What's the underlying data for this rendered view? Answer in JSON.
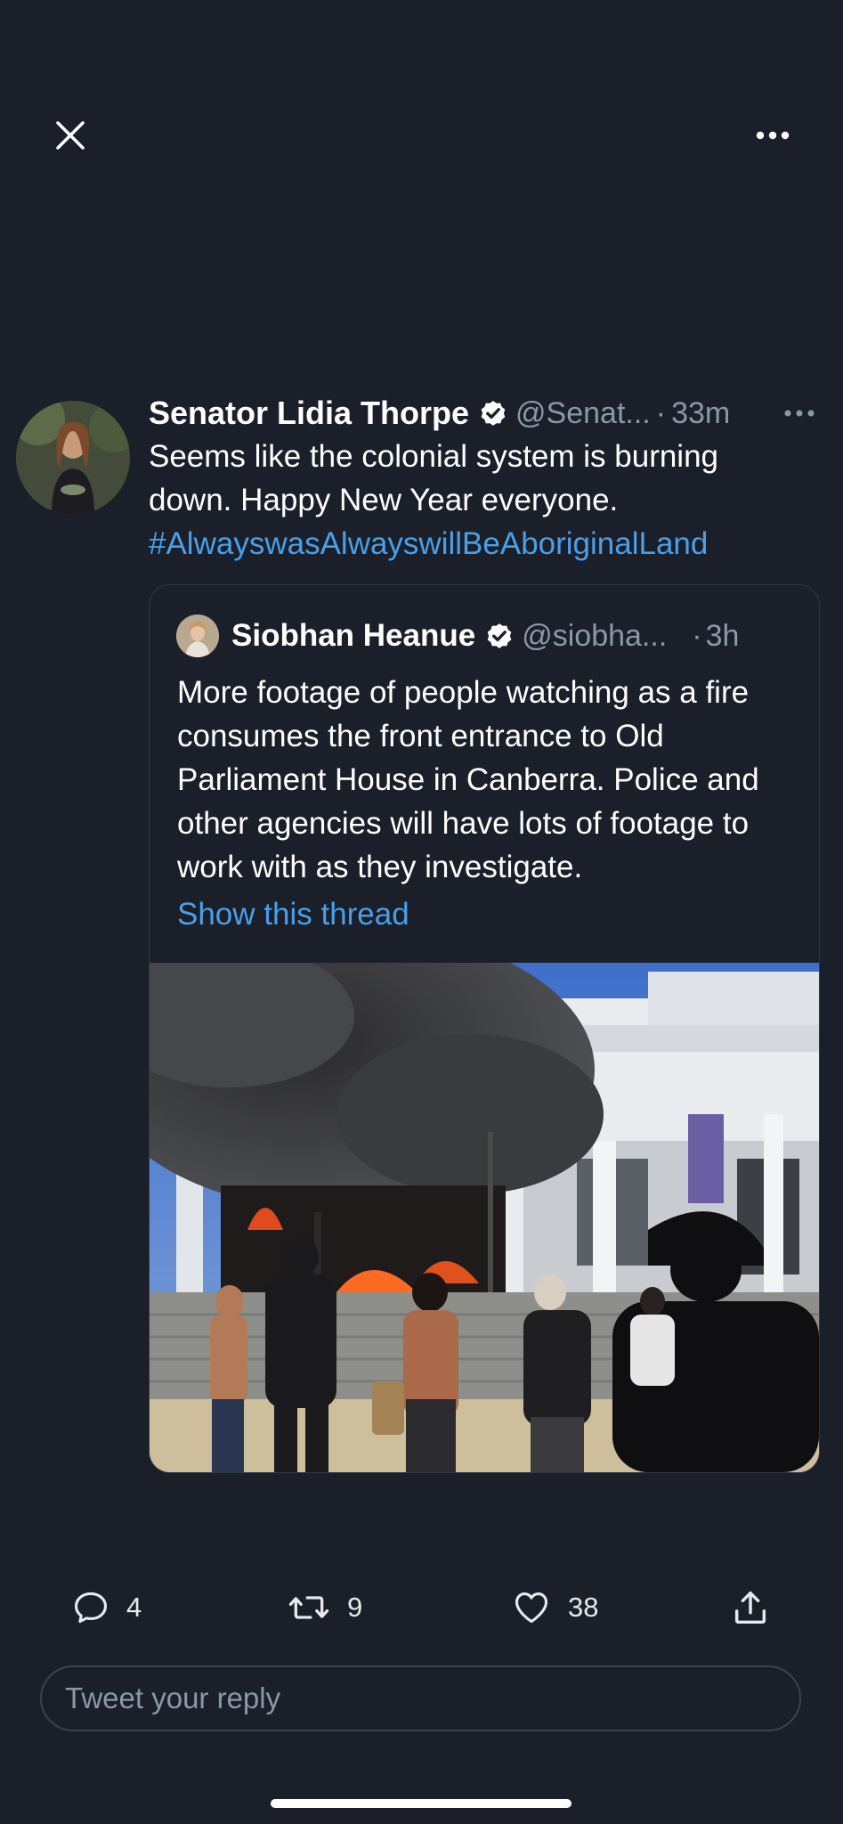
{
  "tweet": {
    "author_name": "Senator Lidia Thorpe",
    "author_handle": "@Senat...",
    "separator": "·",
    "time": "33m",
    "text": "Seems like the colonial system is burning down. Happy New Year everyone.",
    "hashtag": "#AlwayswasAlwayswillBeAboriginalLand"
  },
  "quote": {
    "author_name": "Siobhan Heanue",
    "author_handle": "@siobha...",
    "separator": "·",
    "time": "3h",
    "text": "More footage of people watching as a fire consumes the front entrance to Old Parliament House in Canberra. Police and other agencies will have lots of footage to work with as they investigate.",
    "show_thread": "Show this thread"
  },
  "actions": {
    "replies": "4",
    "retweets": "9",
    "likes": "38"
  },
  "reply": {
    "placeholder": "Tweet your reply"
  },
  "colors": {
    "background": "#1a1f29",
    "link": "#4a9fe8",
    "secondary_text": "#8b98a5"
  },
  "icons": [
    "close-icon",
    "more-horizontal-icon",
    "verified-badge-icon",
    "reply-icon",
    "retweet-icon",
    "like-icon",
    "share-icon"
  ]
}
